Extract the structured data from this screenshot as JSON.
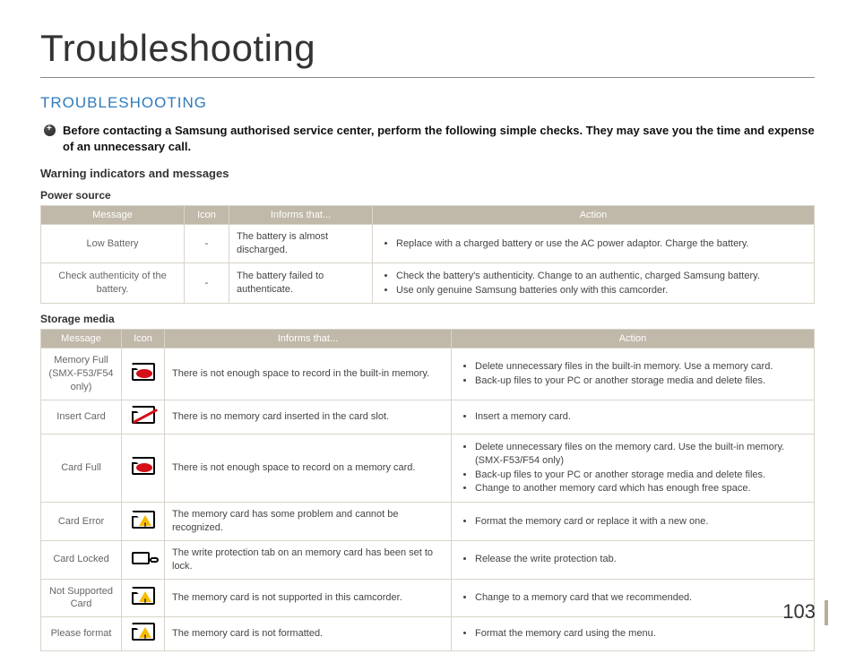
{
  "page_title": "Troubleshooting",
  "section_heading": "TROUBLESHOOTING",
  "intro_text": "Before contacting a Samsung authorised service center, perform the following simple checks. They may save you the time and expense of an unnecessary call.",
  "sub_heading": "Warning indicators and messages",
  "tables": {
    "power": {
      "group_label": "Power source",
      "headers": {
        "message": "Message",
        "icon": "Icon",
        "informs": "Informs that...",
        "action": "Action"
      },
      "rows": [
        {
          "message": "Low Battery",
          "icon_text": "-",
          "informs": "The battery is almost discharged.",
          "actions": [
            "Replace with a charged battery or use the AC power adaptor. Charge the battery."
          ]
        },
        {
          "message": "Check authenticity of the battery.",
          "icon_text": "-",
          "informs": "The battery failed to authenticate.",
          "actions": [
            "Check the battery's authenticity. Change to an authentic, charged Samsung battery.",
            "Use only genuine Samsung batteries only with this camcorder."
          ]
        }
      ]
    },
    "storage": {
      "group_label": "Storage media",
      "headers": {
        "message": "Message",
        "icon": "Icon",
        "informs": "Informs that...",
        "action": "Action"
      },
      "rows": [
        {
          "message": "Memory Full (SMX-F53/F54 only)",
          "icon_name": "memory-full-icon",
          "informs": "There is not enough space to record in the built-in memory.",
          "actions": [
            "Delete unnecessary files in the built-in memory. Use a memory card.",
            "Back-up files to your PC or another storage media and delete files."
          ]
        },
        {
          "message": "Insert Card",
          "icon_name": "insert-card-icon",
          "informs": "There is no memory card inserted in the card slot.",
          "actions": [
            "Insert a memory card."
          ]
        },
        {
          "message": "Card Full",
          "icon_name": "card-full-icon",
          "informs": "There is not enough space to record on a memory card.",
          "actions": [
            "Delete unnecessary files on the memory card. Use the built-in memory. (SMX-F53/F54 only)",
            "Back-up files to your PC or another storage media and delete files.",
            "Change to another memory card which has enough free space."
          ]
        },
        {
          "message": "Card Error",
          "icon_name": "card-error-icon",
          "informs": "The memory card has some problem and cannot be recognized.",
          "actions": [
            "Format the memory card or replace it with a new one."
          ]
        },
        {
          "message": "Card Locked",
          "icon_name": "card-locked-icon",
          "informs": "The write protection tab on an memory card has been set to lock.",
          "actions": [
            "Release the write protection tab."
          ]
        },
        {
          "message": "Not Supported Card",
          "icon_name": "not-supported-card-icon",
          "informs": "The memory card is not supported in this camcorder.",
          "actions": [
            "Change to a memory card that we recommended."
          ]
        },
        {
          "message": "Please format",
          "icon_name": "please-format-icon",
          "informs": "The memory card is not formatted.",
          "actions": [
            "Format the memory card using the menu."
          ]
        }
      ]
    }
  },
  "page_number": "103"
}
